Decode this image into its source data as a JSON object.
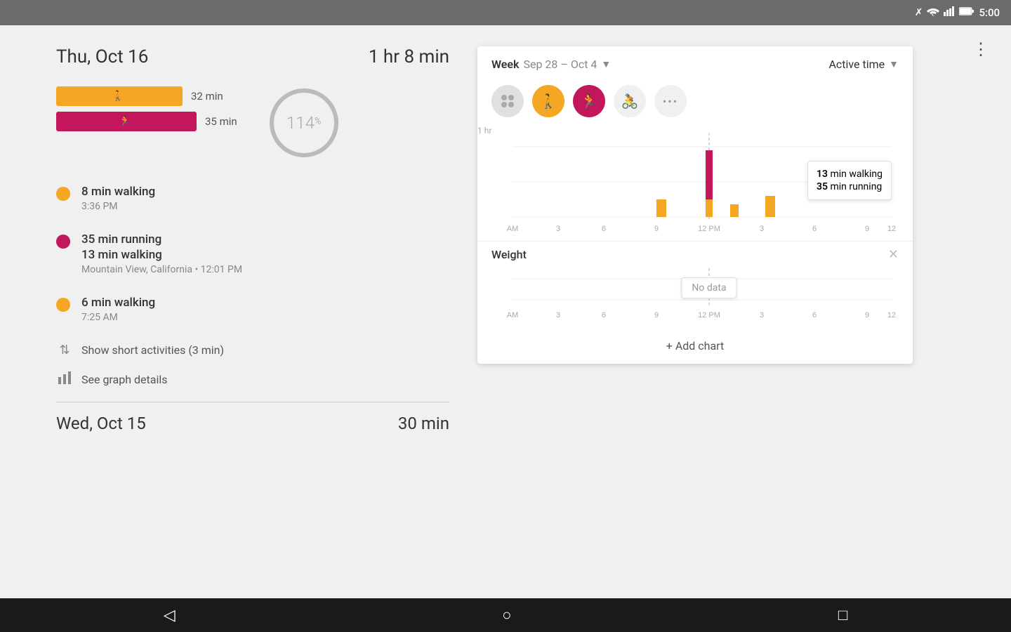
{
  "statusBar": {
    "time": "5:00",
    "icons": [
      "bluetooth",
      "wifi",
      "signal",
      "battery"
    ]
  },
  "leftPanel": {
    "dayTitle": "Thu, Oct 16",
    "dayDuration": "1 hr 8 min",
    "walkingBar": {
      "duration": "32 min",
      "icon": "🚶"
    },
    "runningBar": {
      "duration": "35 min",
      "icon": "🏃"
    },
    "circlePercent": "114",
    "activities": [
      {
        "type": "walking",
        "name": "8 min walking",
        "meta": "3:36 PM",
        "dotColor": "orange"
      },
      {
        "type": "running",
        "name1": "35 min running",
        "name2": "13 min walking",
        "meta": "Mountain View, California • 12:01 PM",
        "dotColor": "pink"
      },
      {
        "type": "walking",
        "name": "6 min walking",
        "meta": "7:25 AM",
        "dotColor": "orange"
      }
    ],
    "showShortActivities": "Show short activities (3 min)",
    "seeGraphDetails": "See graph details"
  },
  "chart": {
    "weekLabel": "Week",
    "weekRange": "Sep 28 – Oct 4",
    "metricLabel": "Active time",
    "activityIcons": [
      "all",
      "walk",
      "run",
      "bike",
      "more"
    ],
    "yLabel": "1 hr",
    "xLabels": [
      "AM",
      "3",
      "6",
      "9",
      "12 PM",
      "3",
      "6",
      "9",
      "12"
    ],
    "tooltip": {
      "line1bold": "13",
      "line1rest": " min walking",
      "line2bold": "35",
      "line2rest": " min running"
    },
    "weightTitle": "Weight",
    "noData": "No data",
    "addChart": "+ Add chart",
    "xLabelsWeight": [
      "AM",
      "3",
      "6",
      "9",
      "12 PM",
      "3",
      "6",
      "9",
      "12"
    ]
  },
  "bottomDay": {
    "title": "Wed, Oct 15",
    "duration": "30 min"
  },
  "bottomNav": {
    "back": "◁",
    "home": "○",
    "recent": "□"
  }
}
